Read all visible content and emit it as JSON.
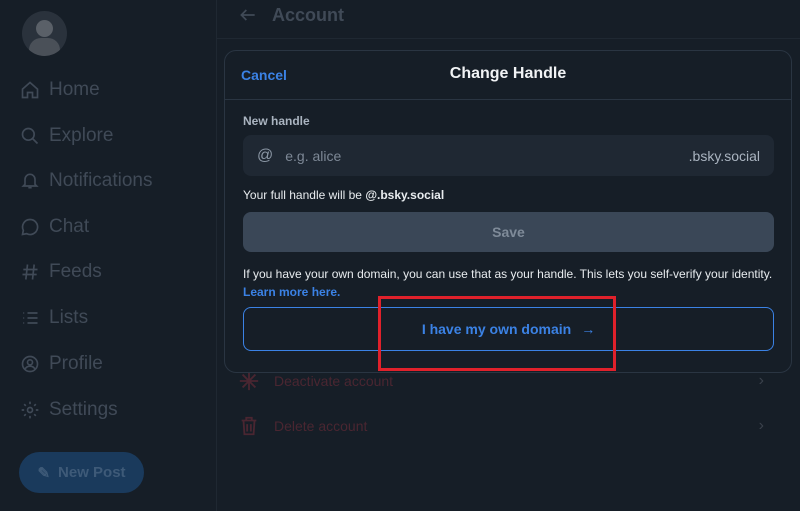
{
  "sidebar": {
    "items": [
      {
        "label": "Home",
        "icon": "home-icon"
      },
      {
        "label": "Explore",
        "icon": "search-icon"
      },
      {
        "label": "Notifications",
        "icon": "bell-icon"
      },
      {
        "label": "Chat",
        "icon": "chat-icon"
      },
      {
        "label": "Feeds",
        "icon": "hash-icon"
      },
      {
        "label": "Lists",
        "icon": "list-icon"
      },
      {
        "label": "Profile",
        "icon": "profile-icon"
      },
      {
        "label": "Settings",
        "icon": "gear-icon"
      }
    ],
    "new_post_label": "New Post"
  },
  "background": {
    "header_title": "Account",
    "deactivate_label": "Deactivate account",
    "delete_label": "Delete account"
  },
  "modal": {
    "cancel_label": "Cancel",
    "title": "Change Handle",
    "new_handle_label": "New handle",
    "input_prefix": "@",
    "input_placeholder": "e.g. alice",
    "input_value": "",
    "input_suffix": ".bsky.social",
    "full_handle_prefix": "Your full handle will be ",
    "full_handle_value": "@.bsky.social",
    "save_label": "Save",
    "info_text": "If you have your own domain, you can use that as your handle. This lets you self-verify your identity. ",
    "learn_more_label": "Learn more here.",
    "own_domain_label": "I have my own domain",
    "own_domain_arrow": "→"
  },
  "colors": {
    "accent": "#3b82e5",
    "background": "#161e27",
    "highlight_box": "#e0212b"
  }
}
